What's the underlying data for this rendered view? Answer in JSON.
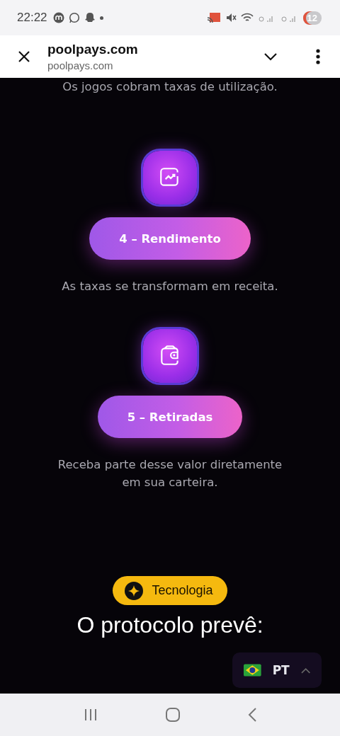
{
  "status_bar": {
    "time": "22:22",
    "battery": "12"
  },
  "browser": {
    "title": "poolpays.com",
    "url": "poolpays.com"
  },
  "intro": "Os jogos cobram taxas de utilização.",
  "steps": [
    {
      "kind": "chart",
      "label": "4 – Rendimento",
      "description": "As taxas se transformam em receita."
    },
    {
      "kind": "wallet",
      "label": "5 – Retiradas",
      "description": "Receba parte desse valor diretamente em sua carteira."
    }
  ],
  "badge": "Tecnologia",
  "heading": "O protocolo prevê:",
  "language": {
    "code": "PT",
    "expanded": false
  }
}
